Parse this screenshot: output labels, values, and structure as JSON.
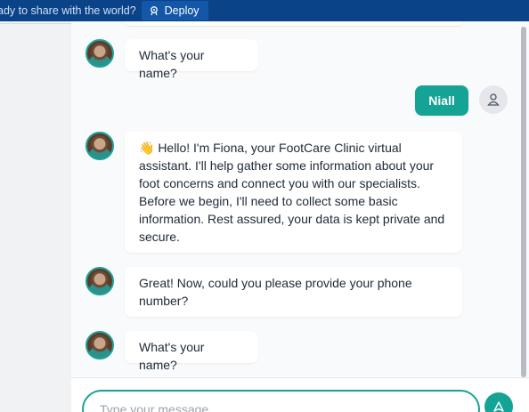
{
  "topbar": {
    "message": "ady to share with the world?",
    "deploy_label": "Deploy"
  },
  "chat": {
    "messages": [
      {
        "sender": "bot",
        "text": "What's your name?"
      },
      {
        "sender": "user",
        "text": "Niall"
      },
      {
        "sender": "bot",
        "text": "👋 Hello! I'm Fiona, your FootCare Clinic virtual assistant. I'll help gather some information about your foot concerns and connect you with our specialists. Before we begin, I'll need to collect some basic information. Rest assured, your data is kept private and secure."
      },
      {
        "sender": "bot",
        "text": "Great! Now, could you please provide your phone number?"
      },
      {
        "sender": "bot",
        "text": "What's your name?"
      }
    ]
  },
  "input": {
    "placeholder": "Type your message..."
  },
  "colors": {
    "accent": "#14a394",
    "topbar": "#0b4388"
  }
}
